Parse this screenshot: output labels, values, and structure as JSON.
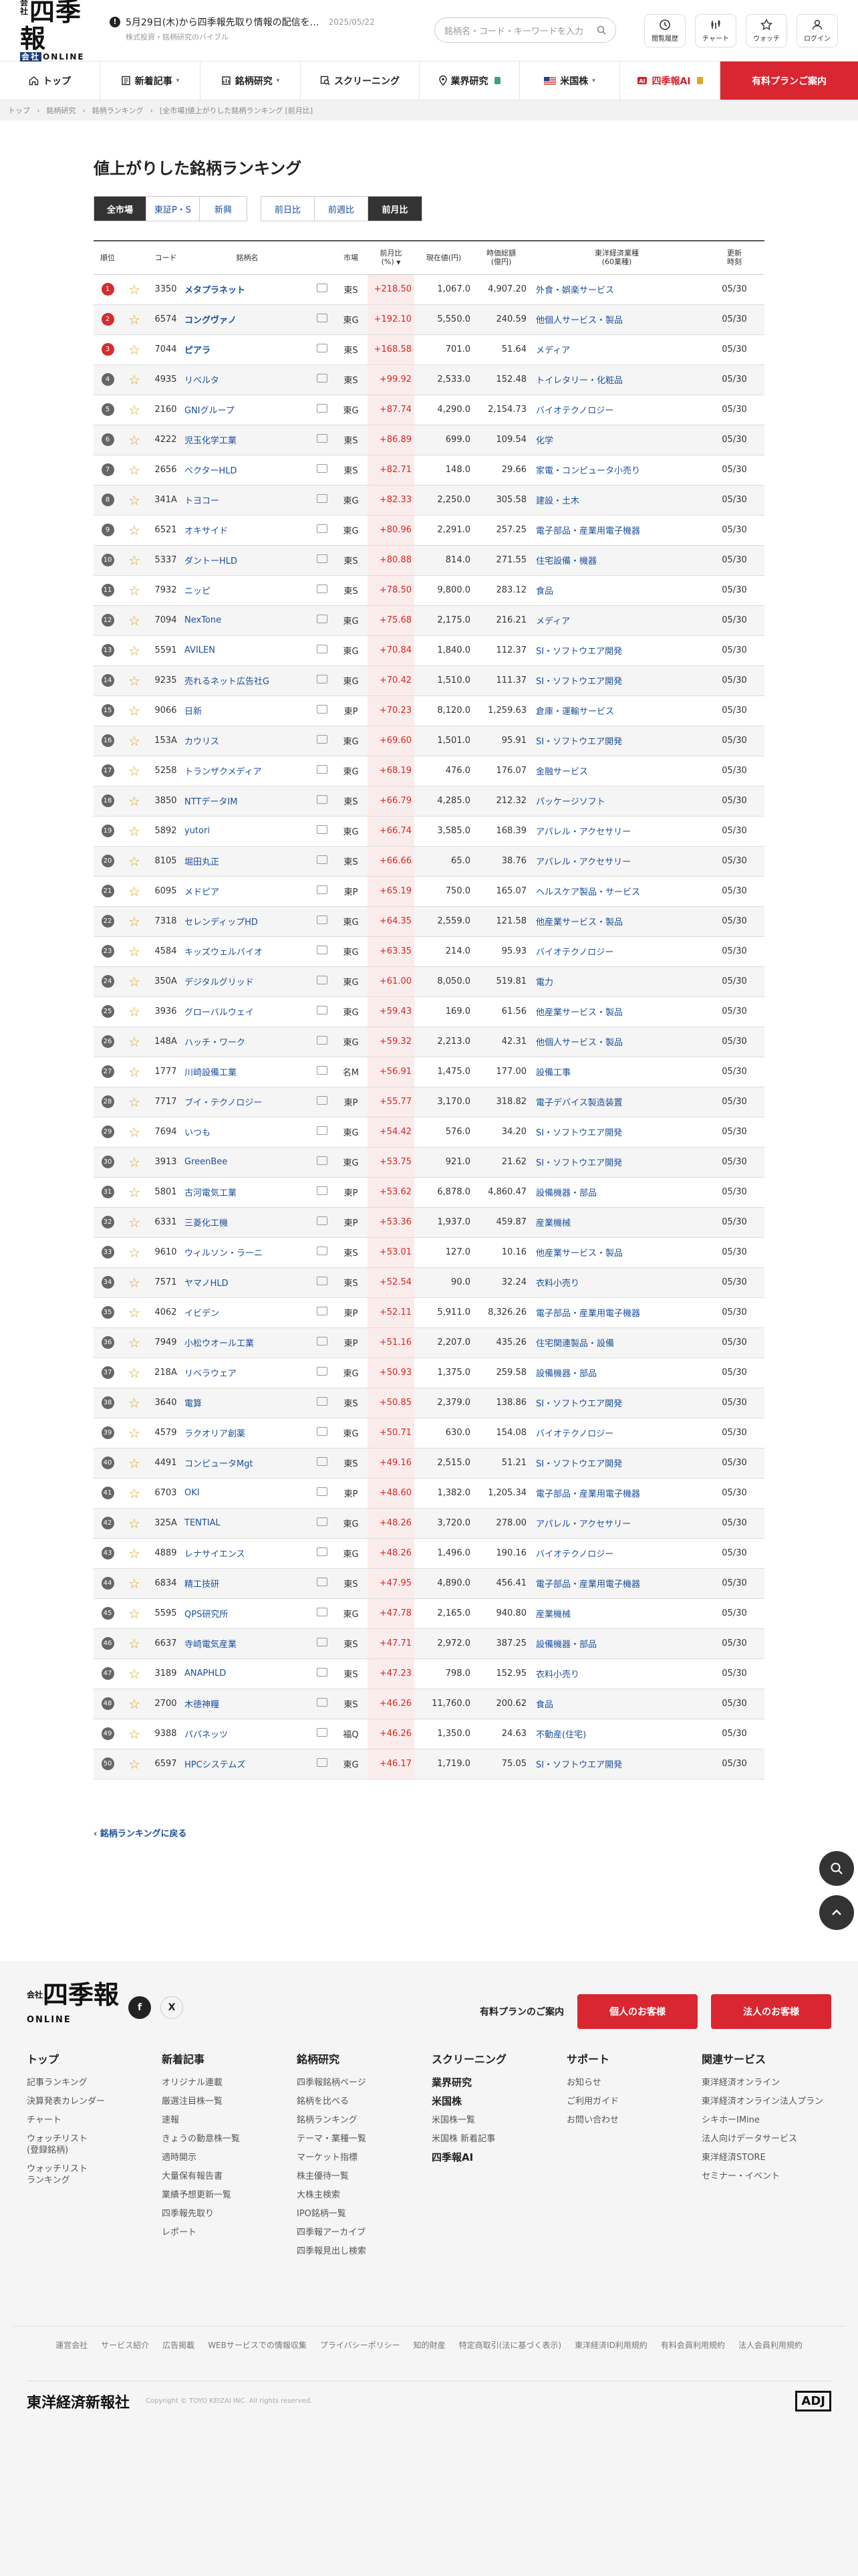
{
  "header": {
    "logo_main": "四季報",
    "logo_corner": "会社",
    "logo_sub": "ONLINE",
    "news_text": "5月29日(木)から四季報先取り情報の配信を…",
    "news_date": "2025/05/22",
    "tagline": "株式投資・銘柄研究のバイブル",
    "search_placeholder": "銘柄名・コード・キーワードを入力",
    "buttons": [
      {
        "label": "閲覧履歴",
        "icon": "history-icon"
      },
      {
        "label": "チャート",
        "icon": "chart-icon"
      },
      {
        "label": "ウォッチ",
        "icon": "star-icon"
      },
      {
        "label": "ログイン",
        "icon": "user-icon"
      }
    ]
  },
  "nav": {
    "items": [
      {
        "label": "トップ",
        "icon": "home-icon",
        "chev": ""
      },
      {
        "label": "新着記事",
        "icon": "article-icon",
        "chev": "▾"
      },
      {
        "label": "銘柄研究",
        "icon": "research-icon",
        "chev": "▾"
      },
      {
        "label": "スクリーニング",
        "icon": "screening-icon",
        "chev": ""
      },
      {
        "label": "業界研究",
        "icon": "pin-icon",
        "chev": ""
      },
      {
        "label": "米国株",
        "icon": "us-flag-icon",
        "chev": "▾"
      },
      {
        "label": "四季報AI",
        "icon": "ai-icon",
        "chev": ""
      }
    ],
    "cta": "有料プランご案内"
  },
  "breadcrumb": [
    "トップ",
    "銘柄研究",
    "銘柄ランキング",
    "[全市場]値上がりした銘柄ランキング [前月比]"
  ],
  "page": {
    "title": "値上がりした銘柄ランキング",
    "market_filters": [
      "全市場",
      "東証P・S",
      "新興"
    ],
    "period_filters": [
      "前日比",
      "前週比",
      "前月比"
    ],
    "active_market": 0,
    "active_period": 2,
    "columns": [
      "順位",
      "コード",
      "銘柄名",
      "市場",
      "前月比\n(%)",
      "現在値(円)",
      "時価総額\n(億円)",
      "東洋経済業種\n(60業種)",
      "更新\n時刻"
    ],
    "sort_marker": "▼",
    "back_link": "銘柄ランキングに戻る"
  },
  "rows": [
    [
      "1",
      "3350",
      "メタプラネット",
      "東S",
      "+218.50",
      "1,067.0",
      "4,907.20",
      "外食・娯楽サービス",
      "05/30"
    ],
    [
      "2",
      "6574",
      "コングヴァノ",
      "東G",
      "+192.10",
      "5,550.0",
      "240.59",
      "他個人サービス・製品",
      "05/30"
    ],
    [
      "3",
      "7044",
      "ピアラ",
      "東S",
      "+168.58",
      "701.0",
      "51.64",
      "メディア",
      "05/30"
    ],
    [
      "4",
      "4935",
      "リベルタ",
      "東S",
      "+99.92",
      "2,533.0",
      "152.48",
      "トイレタリー・化粧品",
      "05/30"
    ],
    [
      "5",
      "2160",
      "GNIグループ",
      "東G",
      "+87.74",
      "4,290.0",
      "2,154.73",
      "バイオテクノロジー",
      "05/30"
    ],
    [
      "6",
      "4222",
      "児玉化学工業",
      "東S",
      "+86.89",
      "699.0",
      "109.54",
      "化学",
      "05/30"
    ],
    [
      "7",
      "2656",
      "ベクターHLD",
      "東S",
      "+82.71",
      "148.0",
      "29.66",
      "家電・コンピュータ小売り",
      "05/30"
    ],
    [
      "8",
      "341A",
      "トヨコー",
      "東G",
      "+82.33",
      "2,250.0",
      "305.58",
      "建設・土木",
      "05/30"
    ],
    [
      "9",
      "6521",
      "オキサイド",
      "東G",
      "+80.96",
      "2,291.0",
      "257.25",
      "電子部品・産業用電子機器",
      "05/30"
    ],
    [
      "10",
      "5337",
      "ダントーHLD",
      "東S",
      "+80.88",
      "814.0",
      "271.55",
      "住宅設備・機器",
      "05/30"
    ],
    [
      "11",
      "7932",
      "ニッピ",
      "東S",
      "+78.50",
      "9,800.0",
      "283.12",
      "食品",
      "05/30"
    ],
    [
      "12",
      "7094",
      "NexTone",
      "東G",
      "+75.68",
      "2,175.0",
      "216.21",
      "メディア",
      "05/30"
    ],
    [
      "13",
      "5591",
      "AVILEN",
      "東G",
      "+70.84",
      "1,840.0",
      "112.37",
      "SI・ソフトウエア開発",
      "05/30"
    ],
    [
      "14",
      "9235",
      "売れるネット広告社G",
      "東G",
      "+70.42",
      "1,510.0",
      "111.37",
      "SI・ソフトウエア開発",
      "05/30"
    ],
    [
      "15",
      "9066",
      "日新",
      "東P",
      "+70.23",
      "8,120.0",
      "1,259.63",
      "倉庫・運輸サービス",
      "05/30"
    ],
    [
      "16",
      "153A",
      "カウリス",
      "東G",
      "+69.60",
      "1,501.0",
      "95.91",
      "SI・ソフトウエア開発",
      "05/30"
    ],
    [
      "17",
      "5258",
      "トランザクメディア",
      "東G",
      "+68.19",
      "476.0",
      "176.07",
      "金融サービス",
      "05/30"
    ],
    [
      "18",
      "3850",
      "NTTデータIM",
      "東S",
      "+66.79",
      "4,285.0",
      "212.32",
      "パッケージソフト",
      "05/30"
    ],
    [
      "19",
      "5892",
      "yutori",
      "東G",
      "+66.74",
      "3,585.0",
      "168.39",
      "アパレル・アクセサリー",
      "05/30"
    ],
    [
      "20",
      "8105",
      "堀田丸正",
      "東S",
      "+66.66",
      "65.0",
      "38.76",
      "アパレル・アクセサリー",
      "05/30"
    ],
    [
      "21",
      "6095",
      "メドピア",
      "東P",
      "+65.19",
      "750.0",
      "165.07",
      "ヘルスケア製品・サービス",
      "05/30"
    ],
    [
      "22",
      "7318",
      "セレンディップHD",
      "東G",
      "+64.35",
      "2,559.0",
      "121.58",
      "他産業サービス・製品",
      "05/30"
    ],
    [
      "23",
      "4584",
      "キッズウェルバイオ",
      "東G",
      "+63.35",
      "214.0",
      "95.93",
      "バイオテクノロジー",
      "05/30"
    ],
    [
      "24",
      "350A",
      "デジタルグリッド",
      "東G",
      "+61.00",
      "8,050.0",
      "519.81",
      "電力",
      "05/30"
    ],
    [
      "25",
      "3936",
      "グローバルウェイ",
      "東G",
      "+59.43",
      "169.0",
      "61.56",
      "他産業サービス・製品",
      "05/30"
    ],
    [
      "26",
      "148A",
      "ハッチ・ワーク",
      "東G",
      "+59.32",
      "2,213.0",
      "42.31",
      "他個人サービス・製品",
      "05/30"
    ],
    [
      "27",
      "1777",
      "川崎設備工業",
      "名M",
      "+56.91",
      "1,475.0",
      "177.00",
      "設備工事",
      "05/30"
    ],
    [
      "28",
      "7717",
      "ブイ・テクノロジー",
      "東P",
      "+55.77",
      "3,170.0",
      "318.82",
      "電子デバイス製造装置",
      "05/30"
    ],
    [
      "29",
      "7694",
      "いつも",
      "東G",
      "+54.42",
      "576.0",
      "34.20",
      "SI・ソフトウエア開発",
      "05/30"
    ],
    [
      "30",
      "3913",
      "GreenBee",
      "東G",
      "+53.75",
      "921.0",
      "21.62",
      "SI・ソフトウエア開発",
      "05/30"
    ],
    [
      "31",
      "5801",
      "古河電気工業",
      "東P",
      "+53.62",
      "6,878.0",
      "4,860.47",
      "設備機器・部品",
      "05/30"
    ],
    [
      "32",
      "6331",
      "三菱化工機",
      "東P",
      "+53.36",
      "1,937.0",
      "459.87",
      "産業機械",
      "05/30"
    ],
    [
      "33",
      "9610",
      "ウィルソン・ラーニ",
      "東S",
      "+53.01",
      "127.0",
      "10.16",
      "他産業サービス・製品",
      "05/30"
    ],
    [
      "34",
      "7571",
      "ヤマノHLD",
      "東S",
      "+52.54",
      "90.0",
      "32.24",
      "衣料小売り",
      "05/30"
    ],
    [
      "35",
      "4062",
      "イビデン",
      "東P",
      "+52.11",
      "5,911.0",
      "8,326.26",
      "電子部品・産業用電子機器",
      "05/30"
    ],
    [
      "36",
      "7949",
      "小松ウオール工業",
      "東P",
      "+51.16",
      "2,207.0",
      "435.26",
      "住宅関連製品・設備",
      "05/30"
    ],
    [
      "37",
      "218A",
      "リベラウェア",
      "東G",
      "+50.93",
      "1,375.0",
      "259.58",
      "設備機器・部品",
      "05/30"
    ],
    [
      "38",
      "3640",
      "電算",
      "東S",
      "+50.85",
      "2,379.0",
      "138.86",
      "SI・ソフトウエア開発",
      "05/30"
    ],
    [
      "39",
      "4579",
      "ラクオリア創薬",
      "東G",
      "+50.71",
      "630.0",
      "154.08",
      "バイオテクノロジー",
      "05/30"
    ],
    [
      "40",
      "4491",
      "コンピュータMgt",
      "東S",
      "+49.16",
      "2,515.0",
      "51.21",
      "SI・ソフトウエア開発",
      "05/30"
    ],
    [
      "41",
      "6703",
      "OKI",
      "東P",
      "+48.60",
      "1,382.0",
      "1,205.34",
      "電子部品・産業用電子機器",
      "05/30"
    ],
    [
      "42",
      "325A",
      "TENTIAL",
      "東G",
      "+48.26",
      "3,720.0",
      "278.00",
      "アパレル・アクセサリー",
      "05/30"
    ],
    [
      "43",
      "4889",
      "レナサイエンス",
      "東G",
      "+48.26",
      "1,496.0",
      "190.16",
      "バイオテクノロジー",
      "05/30"
    ],
    [
      "44",
      "6834",
      "精工技研",
      "東S",
      "+47.95",
      "4,890.0",
      "456.41",
      "電子部品・産業用電子機器",
      "05/30"
    ],
    [
      "45",
      "5595",
      "QPS研究所",
      "東G",
      "+47.78",
      "2,165.0",
      "940.80",
      "産業機械",
      "05/30"
    ],
    [
      "46",
      "6637",
      "寺崎電気産業",
      "東S",
      "+47.71",
      "2,972.0",
      "387.25",
      "設備機器・部品",
      "05/30"
    ],
    [
      "47",
      "3189",
      "ANAPHLD",
      "東S",
      "+47.23",
      "798.0",
      "152.95",
      "衣料小売り",
      "05/30"
    ],
    [
      "48",
      "2700",
      "木徳神糧",
      "東S",
      "+46.26",
      "11,760.0",
      "200.62",
      "食品",
      "05/30"
    ],
    [
      "49",
      "9388",
      "パパネッツ",
      "福Q",
      "+46.26",
      "1,350.0",
      "24.63",
      "不動産(住宅)",
      "05/30"
    ],
    [
      "50",
      "6597",
      "HPCシステムズ",
      "東G",
      "+46.17",
      "1,719.0",
      "75.05",
      "SI・ソフトウエア開発",
      "05/30"
    ]
  ],
  "footer": {
    "logo": "四季報",
    "logo_corner": "会社",
    "logo_sub": "ONLINE",
    "plan_label": "有料プランのご案内",
    "plan_buttons": [
      "個人のお客様",
      "法人のお客様"
    ],
    "columns": [
      {
        "title": "トップ",
        "items": [
          "記事ランキング",
          "決算発表カレンダー",
          "チャート",
          "ウォッチリスト\n(登録銘柄)",
          "ウォッチリスト\nランキング"
        ]
      },
      {
        "title": "新着記事",
        "items": [
          "オリジナル連載",
          "厳選注目株一覧",
          "速報",
          "きょうの動意株一覧",
          "適時開示",
          "大量保有報告書",
          "業績予想更新一覧",
          "四季報先取り",
          "レポート"
        ]
      },
      {
        "title": "銘柄研究",
        "items": [
          "四季報銘柄ページ",
          "銘柄を比べる",
          "銘柄ランキング",
          "テーマ・業種一覧",
          "マーケット指標",
          "株主優待一覧",
          "大株主検索",
          "IPO銘柄一覧",
          "四季報アーカイブ",
          "四季報見出し検索"
        ]
      },
      {
        "title": "スクリーニング",
        "items": []
      },
      {
        "title": "サポート",
        "items": [
          "お知らせ",
          "ご利用ガイド",
          "お問い合わせ"
        ]
      },
      {
        "title": "関連サービス",
        "items": [
          "東洋経済オンライン",
          "東洋経済オンライン法人プラン",
          "シキホーIMine",
          "法人向けデータサービス",
          "東洋経済STORE",
          "セミナー・イベント"
        ]
      }
    ],
    "col4_extra": [
      {
        "label": "業界研究",
        "big": true
      },
      {
        "label": "米国株",
        "big": true
      },
      {
        "label": "米国株一覧",
        "big": false
      },
      {
        "label": "米国株 新着記事",
        "big": false
      },
      {
        "label": "四季報AI",
        "big": true
      }
    ],
    "links": [
      "運営会社",
      "サービス紹介",
      "広告掲載",
      "WEBサービスでの情報収集",
      "プライバシーポリシー",
      "知的財産",
      "特定商取引(法に基づく表示)",
      "東洋経済ID利用規約",
      "有料会員利用規約",
      "法人会員利用規約"
    ],
    "company": "東洋経済新報社",
    "copyright": "Copyright © TOYO KEIZAI INC. All rights reserved.",
    "badge": "ADJ"
  }
}
